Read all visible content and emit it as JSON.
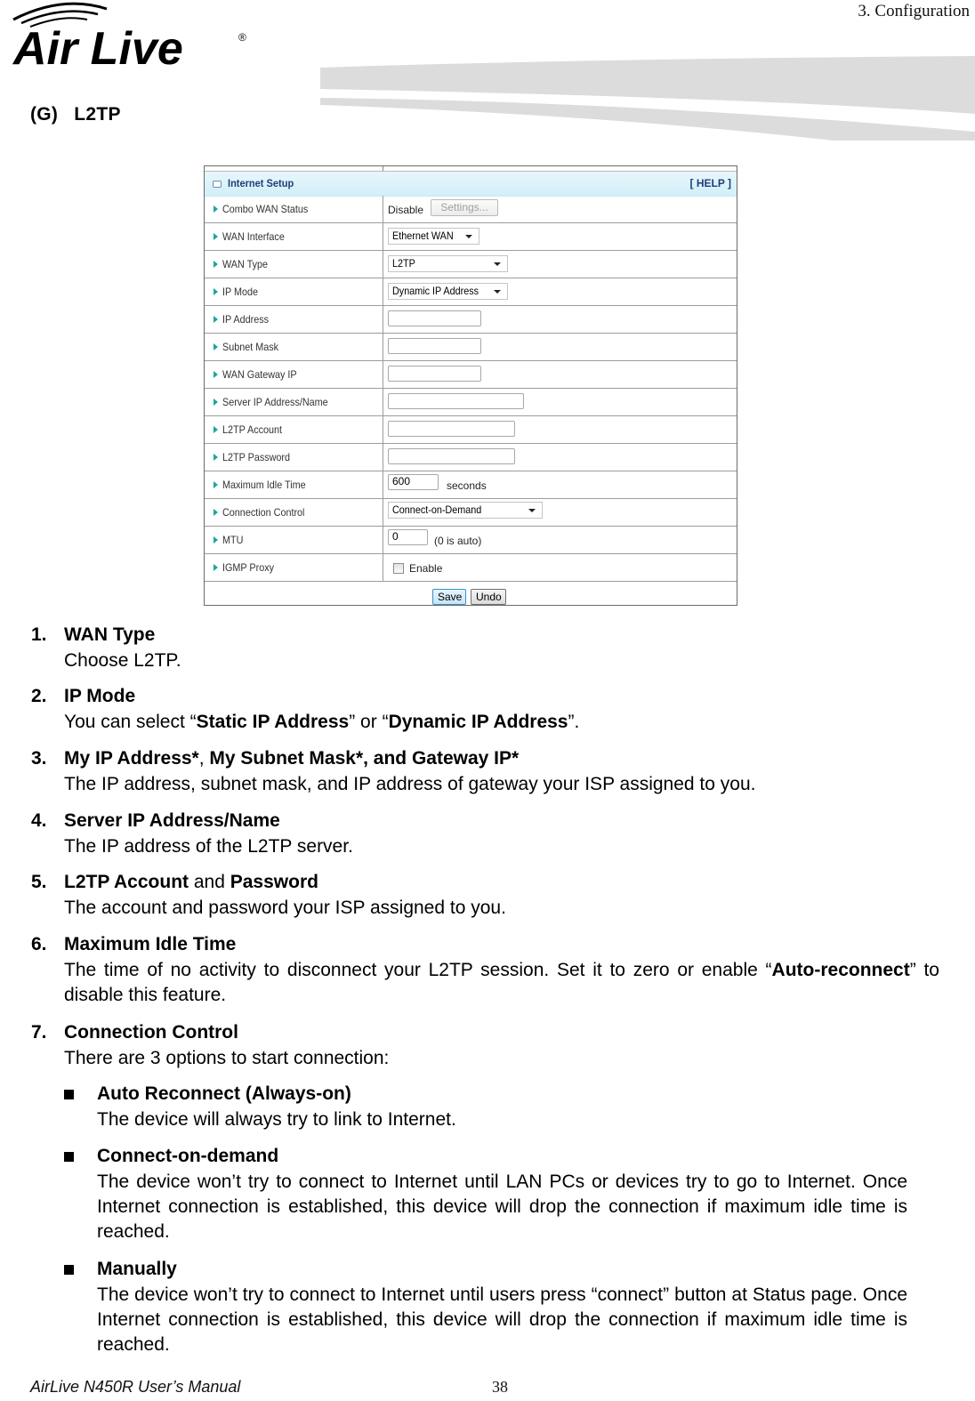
{
  "header": {
    "brand": "Air Live",
    "chapter": "3.  Configuration"
  },
  "section": {
    "label": "(G)",
    "title": "L2TP"
  },
  "ui": {
    "panel_title": "Internet Setup",
    "help_link": "[ HELP ]",
    "rows": [
      {
        "label": "Combo WAN Status",
        "value": "Disable",
        "button": "Settings..."
      },
      {
        "label": "WAN Interface",
        "select": "Ethernet WAN"
      },
      {
        "label": "WAN Type",
        "select": "L2TP"
      },
      {
        "label": "IP Mode",
        "select": "Dynamic IP Address"
      },
      {
        "label": "IP Address",
        "input": ""
      },
      {
        "label": "Subnet Mask",
        "input": ""
      },
      {
        "label": "WAN Gateway IP",
        "input": ""
      },
      {
        "label": "Server IP Address/Name",
        "input": ""
      },
      {
        "label": "L2TP Account",
        "input": ""
      },
      {
        "label": "L2TP Password",
        "input": ""
      },
      {
        "label": "Maximum Idle Time",
        "input": "600",
        "suffix": "seconds"
      },
      {
        "label": "Connection Control",
        "select": "Connect-on-Demand"
      },
      {
        "label": "MTU",
        "input": "0",
        "suffix": "(0 is auto)"
      },
      {
        "label": "IGMP Proxy",
        "checkbox_label": "Enable",
        "checked": false
      }
    ],
    "save_label": "Save",
    "undo_label": "Undo"
  },
  "items": [
    {
      "num": "1.",
      "title": "WAN Type",
      "desc": "Choose L2TP."
    },
    {
      "num": "2.",
      "title": "IP Mode",
      "desc_pre": "You can select “",
      "desc_b1": "Static IP Address",
      "desc_mid": "” or “",
      "desc_b2": "Dynamic IP Address",
      "desc_post": "”."
    },
    {
      "num": "3.",
      "title_b1": "My IP Address*",
      "title_sep": ", ",
      "title_b2": "My Subnet Mask*, and Gateway IP*",
      "desc": "The IP address, subnet mask, and IP address of gateway your ISP assigned to you."
    },
    {
      "num": "4.",
      "title": "Server IP Address/Name",
      "desc": "The IP address of the L2TP server."
    },
    {
      "num": "5.",
      "title_b1": "L2TP Account",
      "title_sep": " and ",
      "title_b2": "Password",
      "desc": "The account and password your ISP assigned to you."
    },
    {
      "num": "6.",
      "title": "Maximum Idle Time",
      "desc_pre": "The time of no activity to disconnect your L2TP session. Set it to zero or enable “",
      "desc_b1": "Auto-reconnect",
      "desc_post": "” to disable this feature."
    },
    {
      "num": "7.",
      "title": "Connection Control",
      "desc": "There are 3 options to start connection:"
    }
  ],
  "bullets": [
    {
      "title": "Auto Reconnect (Always-on)",
      "desc": "The device will always try to link to Internet."
    },
    {
      "title": "Connect-on-demand",
      "desc": "The device won’t try to connect to Internet until LAN PCs or devices try to go to Internet. Once Internet connection is established, this device will drop the connection if maximum idle time is reached."
    },
    {
      "title": "Manually",
      "desc": "The device won’t try to connect to Internet until users press “connect” button at Status page. Once Internet connection is established, this device will drop the connection if maximum idle time is reached."
    }
  ],
  "footer": {
    "manual": "AirLive N450R User’s Manual",
    "page": "38"
  }
}
